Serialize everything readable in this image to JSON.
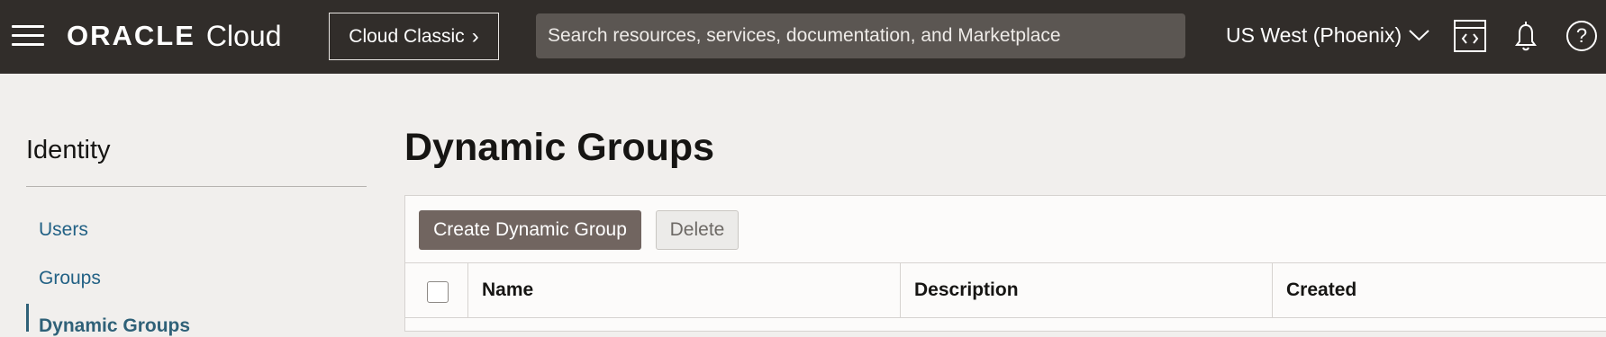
{
  "header": {
    "menu_icon": "hamburger-menu-icon",
    "brand_oracle": "ORACLE",
    "brand_cloud": "Cloud",
    "classic_button": "Cloud Classic",
    "classic_chevron": "›",
    "search_placeholder": "Search resources, services, documentation, and Marketplace",
    "region": "US West (Phoenix)",
    "icons": [
      "developer-tools-icon",
      "notifications-bell-icon",
      "help-question-icon"
    ],
    "help_label": "?"
  },
  "sidebar": {
    "title": "Identity",
    "items": [
      {
        "label": "Users"
      },
      {
        "label": "Groups"
      },
      {
        "label": "Dynamic Groups",
        "active": true
      }
    ]
  },
  "main": {
    "title": "Dynamic Groups",
    "toolbar": {
      "create_button": "Create Dynamic Group",
      "delete_button": "Delete"
    },
    "table": {
      "columns": [
        "Name",
        "Description",
        "Created"
      ]
    }
  },
  "colors": {
    "topbar": "#312d2a",
    "search_bg": "#5b5652",
    "link": "#226185",
    "primary_button": "#716560"
  }
}
